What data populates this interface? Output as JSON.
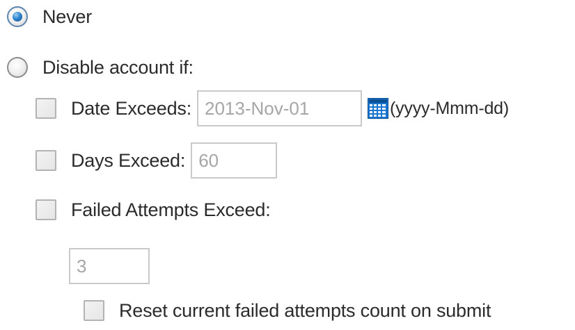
{
  "options": {
    "never": {
      "label": "Never",
      "selected": true
    },
    "disable": {
      "label": "Disable account if:",
      "selected": false
    }
  },
  "date_exceeds": {
    "label": "Date Exceeds:",
    "checked": false,
    "value": "2013-Nov-01",
    "format_hint": "(yyyy-Mmm-dd)",
    "icon": "calendar-icon"
  },
  "days_exceed": {
    "label": "Days Exceed:",
    "checked": false,
    "value": "60"
  },
  "failed_attempts": {
    "label": "Failed Attempts Exceed:",
    "checked": false,
    "value": "3"
  },
  "reset_count": {
    "label": "Reset current failed attempts count on submit",
    "checked": false
  },
  "colors": {
    "radio_selected": "#2f86cf",
    "input_text": "#a6a6a6",
    "calendar_icon": "#1a75d1"
  }
}
